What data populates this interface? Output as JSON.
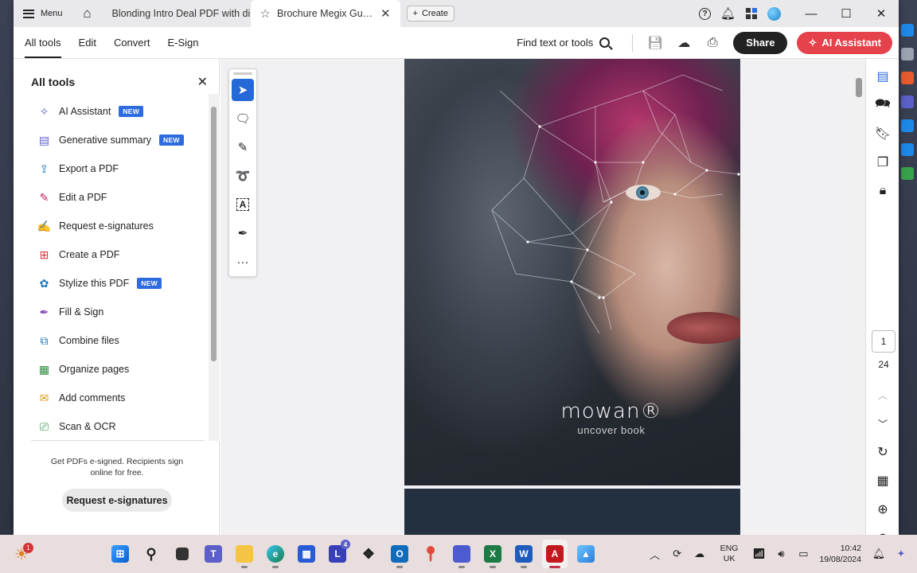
{
  "titlebar": {
    "menu_label": "Menu",
    "tabs": [
      {
        "title": "Blonding Intro Deal PDF with di..."
      },
      {
        "title": "Brochure Megix Guida ..."
      }
    ],
    "create_label": "Create"
  },
  "toolbar": {
    "tabs": [
      "All tools",
      "Edit",
      "Convert",
      "E-Sign"
    ],
    "find_label": "Find text or tools",
    "share_label": "Share",
    "ai_label": "AI Assistant"
  },
  "sidebar": {
    "title": "All tools",
    "items": [
      {
        "label": "AI Assistant",
        "badge": "NEW",
        "icon": "ai-assistant-icon",
        "color": "#5b5fc7"
      },
      {
        "label": "Generative summary",
        "badge": "NEW",
        "icon": "summary-icon",
        "color": "#5b5fc7"
      },
      {
        "label": "Export a PDF",
        "icon": "export-icon",
        "color": "#1a73b8"
      },
      {
        "label": "Edit a PDF",
        "icon": "edit-pdf-icon",
        "color": "#c0266a"
      },
      {
        "label": "Request e-signatures",
        "icon": "request-signature-icon",
        "color": "#7a3fb0"
      },
      {
        "label": "Create a PDF",
        "icon": "create-pdf-icon",
        "color": "#d7373f"
      },
      {
        "label": "Stylize this PDF",
        "badge": "NEW",
        "icon": "stylize-icon",
        "color": "#1a73b8"
      },
      {
        "label": "Fill & Sign",
        "icon": "fill-sign-icon",
        "color": "#7a3fb0"
      },
      {
        "label": "Combine files",
        "icon": "combine-icon",
        "color": "#1a73b8"
      },
      {
        "label": "Organize pages",
        "icon": "organize-icon",
        "color": "#2a8a3a"
      },
      {
        "label": "Add comments",
        "icon": "comment-icon",
        "color": "#d99a1a"
      },
      {
        "label": "Scan & OCR",
        "icon": "scan-icon",
        "color": "#2a8a3a"
      }
    ],
    "promo_text": "Get PDFs e-signed. Recipients sign online for free.",
    "promo_button": "Request e-signatures"
  },
  "document": {
    "brand_name": "mowan®",
    "brand_tagline": "uncover book",
    "current_page": "1",
    "total_pages": "24"
  },
  "taskbar": {
    "weather_badge": "1",
    "outlook_badge": "4",
    "lang_line1": "ENG",
    "lang_line2": "UK",
    "time": "10:42",
    "date": "19/08/2024"
  },
  "colors": {
    "accent_blue": "#2569d6",
    "ai_red": "#e5424c",
    "badge_blue": "#2d6be0"
  }
}
